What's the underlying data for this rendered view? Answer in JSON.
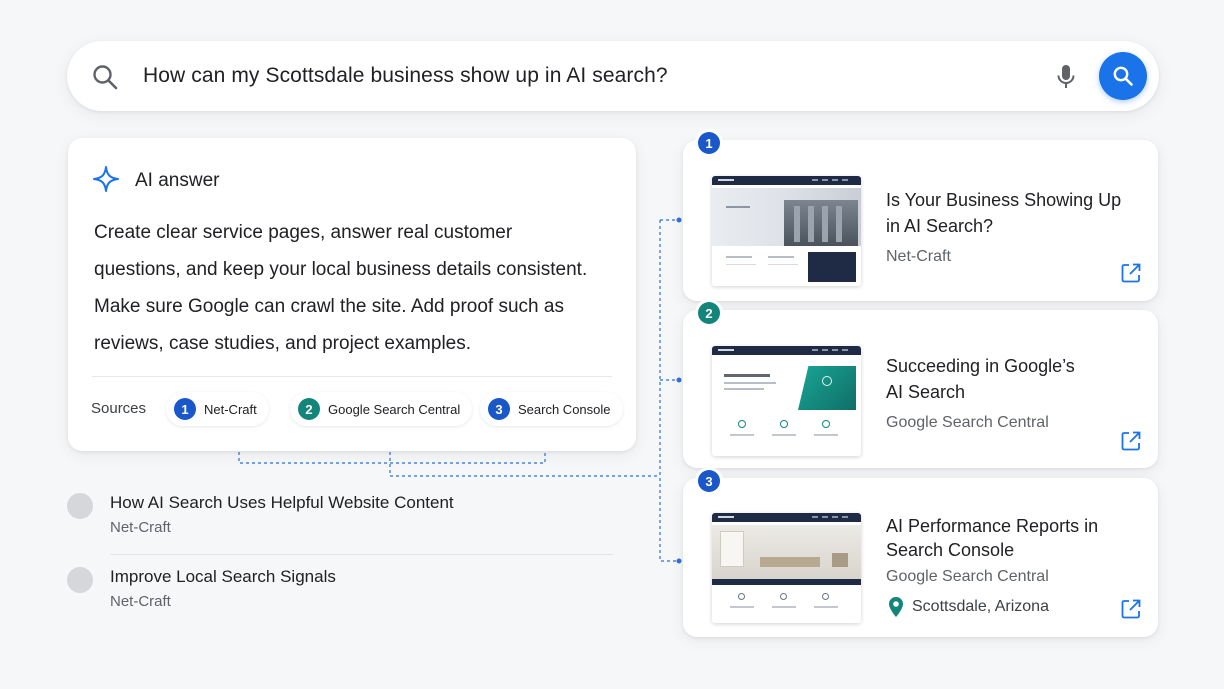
{
  "search": {
    "query": "How can my Scottsdale business show up in AI search?"
  },
  "ai_answer": {
    "title": "AI answer",
    "body": "Create clear service pages, answer real customer questions, and keep your local business details consistent. Make sure Google can crawl the site. Add proof such as reviews, case studies, and project examples.",
    "sources_label": "Sources",
    "chips": [
      {
        "num": "1",
        "label": "Net-Craft",
        "color": "#1a57c9"
      },
      {
        "num": "2",
        "label": "Google Search Central",
        "color": "#14857a"
      },
      {
        "num": "3",
        "label": "Search Console",
        "color": "#1a57c9"
      }
    ]
  },
  "list": [
    {
      "title": "How AI Search Uses Helpful Website Content",
      "source": "Net-Craft"
    },
    {
      "title": "Improve Local Search Signals",
      "source": "Net-Craft"
    }
  ],
  "results": [
    {
      "num": "1",
      "title_line1": "Is Your Business Showing Up",
      "title_line2": "in AI Search?",
      "source": "Net-Craft",
      "color": "#1a57c9"
    },
    {
      "num": "2",
      "title_line1": "Succeeding in Google’s",
      "title_line2": "AI Search",
      "source": "Google Search Central",
      "color": "#14857a"
    },
    {
      "num": "3",
      "title_line1": "AI Performance Reports in",
      "title_line2": "Search Console",
      "source": "Google Search Central",
      "location": "Scottsdale, Arizona",
      "color": "#1a57c9"
    }
  ],
  "colors": {
    "accent_blue": "#1a73e8",
    "teal": "#14857a",
    "connector": "#2f6fd6"
  },
  "icons": [
    "search-icon",
    "mic-icon",
    "sparkle-icon",
    "open-in-new-icon",
    "location-pin-icon"
  ]
}
